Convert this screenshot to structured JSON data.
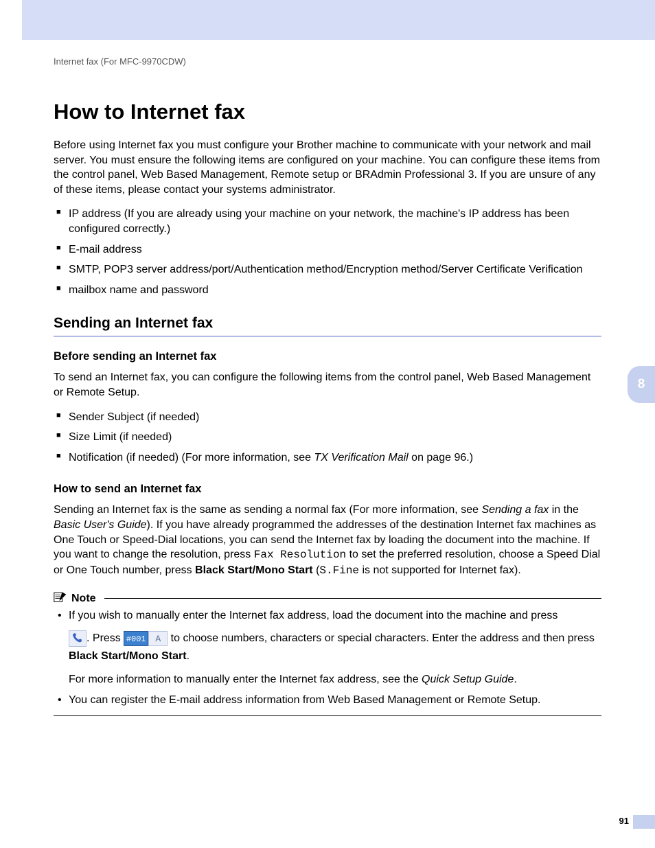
{
  "breadcrumb": "Internet fax (For MFC-9970CDW)",
  "h1": "How to Internet fax",
  "intro": "Before using Internet fax you must configure your Brother machine to communicate with your network and mail server. You must ensure the following items are configured on your machine. You can configure these items from the control panel, Web Based Management, Remote setup or BRAdmin Professional 3. If you are unsure of any of these items, please contact your systems administrator.",
  "configItems": [
    "IP address (If you are already using your machine on your network, the machine's IP address has been configured correctly.)",
    "E-mail address",
    "SMTP, POP3 server address/port/Authentication method/Encryption method/Server Certificate Verification",
    "mailbox name and password"
  ],
  "h2": "Sending an Internet fax",
  "h3a": "Before sending an Internet fax",
  "beforePara": "To send an Internet fax, you can configure the following items from the control panel, Web Based Management or Remote Setup.",
  "beforeItems": {
    "i0": "Sender Subject (if needed)",
    "i1": "Size Limit (if needed)",
    "i2a": "Notification (if needed) (For more information, see ",
    "i2b": "TX Verification Mail",
    "i2c": " on page 96.)"
  },
  "h3b": "How to send an Internet fax",
  "howPara": {
    "a": "Sending an Internet fax is the same as sending a normal fax (For more information, see ",
    "b": "Sending a fax",
    "c": " in the ",
    "d": "Basic User's Guide",
    "e": "). If you have already programmed the addresses of the destination Internet fax machines as One Touch or Speed-Dial locations, you can send the Internet fax by loading the document into the machine. If you want to change the resolution, press ",
    "f": "Fax Resolution",
    "g": " to set the preferred resolution, choose a Speed Dial or One Touch number, press ",
    "h": "Black Start/Mono Start",
    "i": " (",
    "j": "S.Fine",
    "k": " is not supported for Internet fax)."
  },
  "note": {
    "label": "Note",
    "b1a": "If you wish to manually enter the Internet fax address, load the document into the machine and press",
    "b1bPress": ". Press ",
    "key001": "#001",
    "keyA": "A",
    "b1c": " to choose numbers, characters or special characters. Enter the address and then press ",
    "b1d": "Black Start/Mono Start",
    "b1e": ".",
    "b1f": "For more information to manually enter the Internet fax address, see the ",
    "b1g": "Quick Setup Guide",
    "b1h": ".",
    "b2": "You can register the E-mail address information from Web Based Management or Remote Setup."
  },
  "sideTab": "8",
  "pageNumber": "91"
}
